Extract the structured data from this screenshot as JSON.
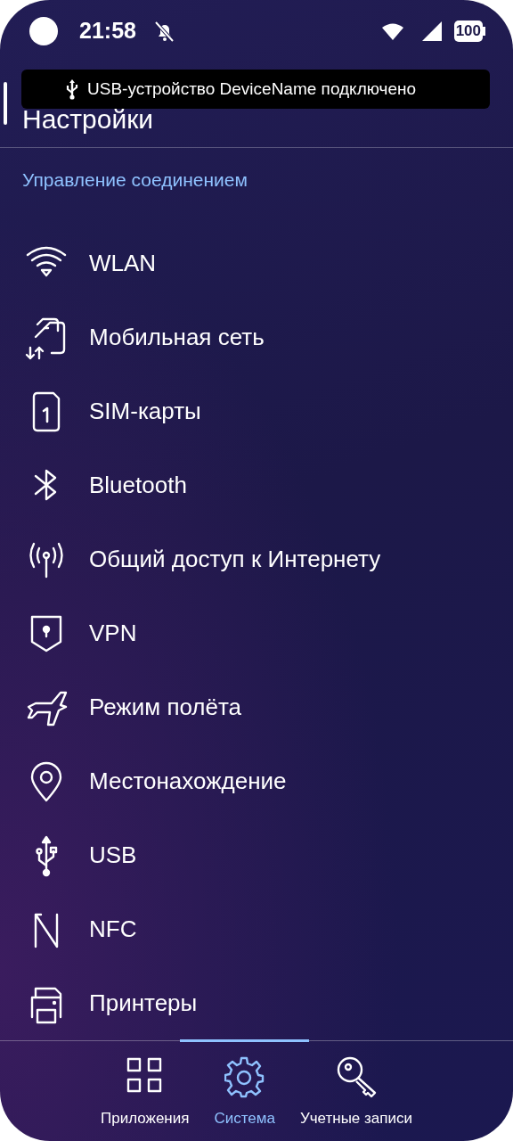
{
  "status_bar": {
    "time": "21:58",
    "battery": "100"
  },
  "title": "Настройки",
  "toast": {
    "text": "USB-устройство DeviceName подключено"
  },
  "section": "Управление соединением",
  "items": [
    {
      "label": "WLAN"
    },
    {
      "label": "Мобильная сеть"
    },
    {
      "label": "SIM-карты"
    },
    {
      "label": "Bluetooth"
    },
    {
      "label": "Общий доступ к Интернету"
    },
    {
      "label": "VPN"
    },
    {
      "label": "Режим полёта"
    },
    {
      "label": "Местонахождение"
    },
    {
      "label": "USB"
    },
    {
      "label": "NFC"
    },
    {
      "label": "Принтеры"
    }
  ],
  "tabs": [
    {
      "label": "Приложения",
      "selected": false
    },
    {
      "label": "Система",
      "selected": true
    },
    {
      "label": "Учетные записи",
      "selected": false
    }
  ]
}
